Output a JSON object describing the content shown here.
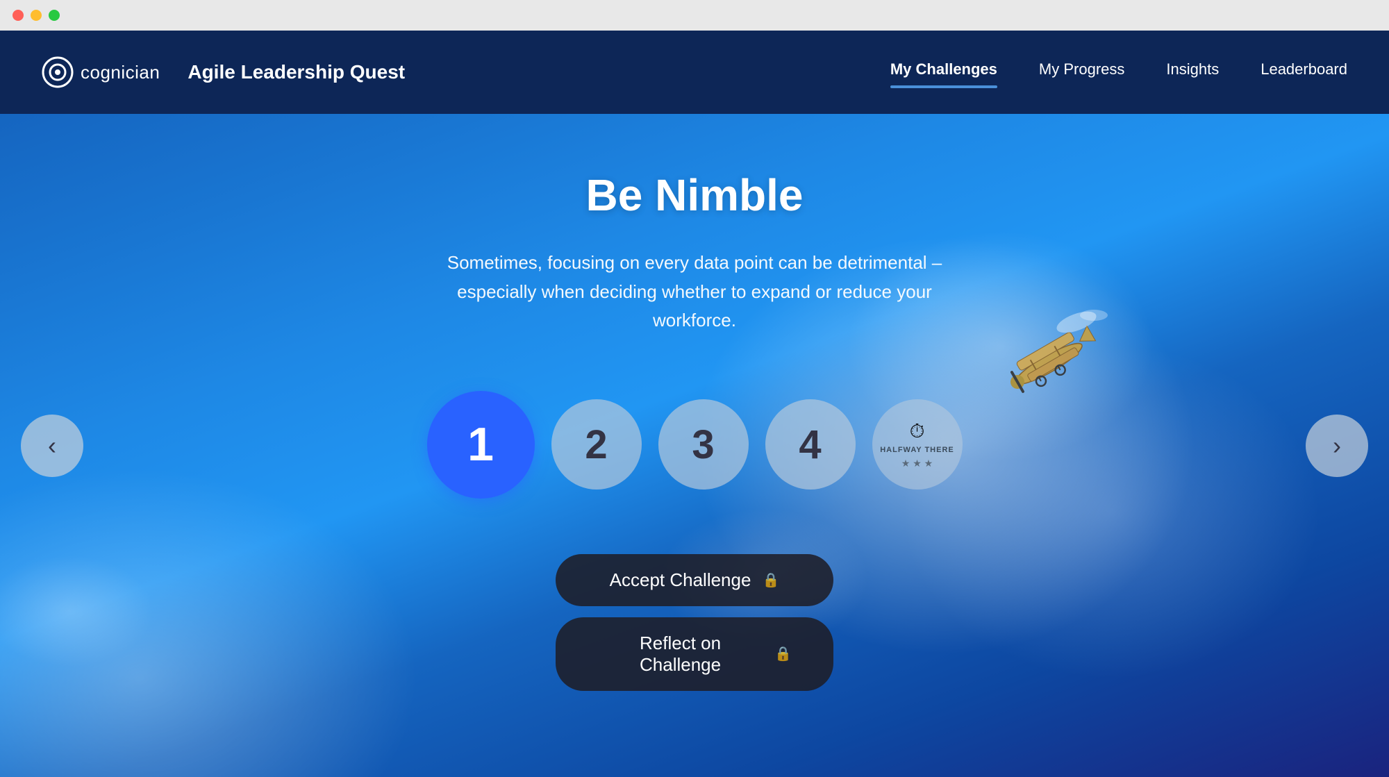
{
  "window": {
    "traffic_lights": [
      "close",
      "minimize",
      "maximize"
    ]
  },
  "header": {
    "logo_text": "cognician",
    "app_title": "Agile Leadership Quest",
    "nav": {
      "items": [
        {
          "id": "my-challenges",
          "label": "My Challenges",
          "active": true
        },
        {
          "id": "my-progress",
          "label": "My Progress",
          "active": false
        },
        {
          "id": "insights",
          "label": "Insights",
          "active": false
        },
        {
          "id": "leaderboard",
          "label": "Leaderboard",
          "active": false
        }
      ]
    }
  },
  "hero": {
    "title": "Be Nimble",
    "subtitle": "Sometimes, focusing on every data point can be detrimental – especially when deciding whether to expand or reduce your workforce.",
    "steps": [
      {
        "number": "1",
        "active": true
      },
      {
        "number": "2",
        "active": false
      },
      {
        "number": "3",
        "active": false
      },
      {
        "number": "4",
        "active": false
      }
    ],
    "badge": {
      "label": "HALFWAY THERE",
      "stars": "★ ★ ★"
    },
    "buttons": [
      {
        "id": "accept-challenge",
        "label": "Accept Challenge",
        "locked": true
      },
      {
        "id": "reflect-on-challenge",
        "label": "Reflect on Challenge",
        "locked": true
      }
    ]
  },
  "nav_arrows": {
    "left": "‹",
    "right": "›"
  }
}
